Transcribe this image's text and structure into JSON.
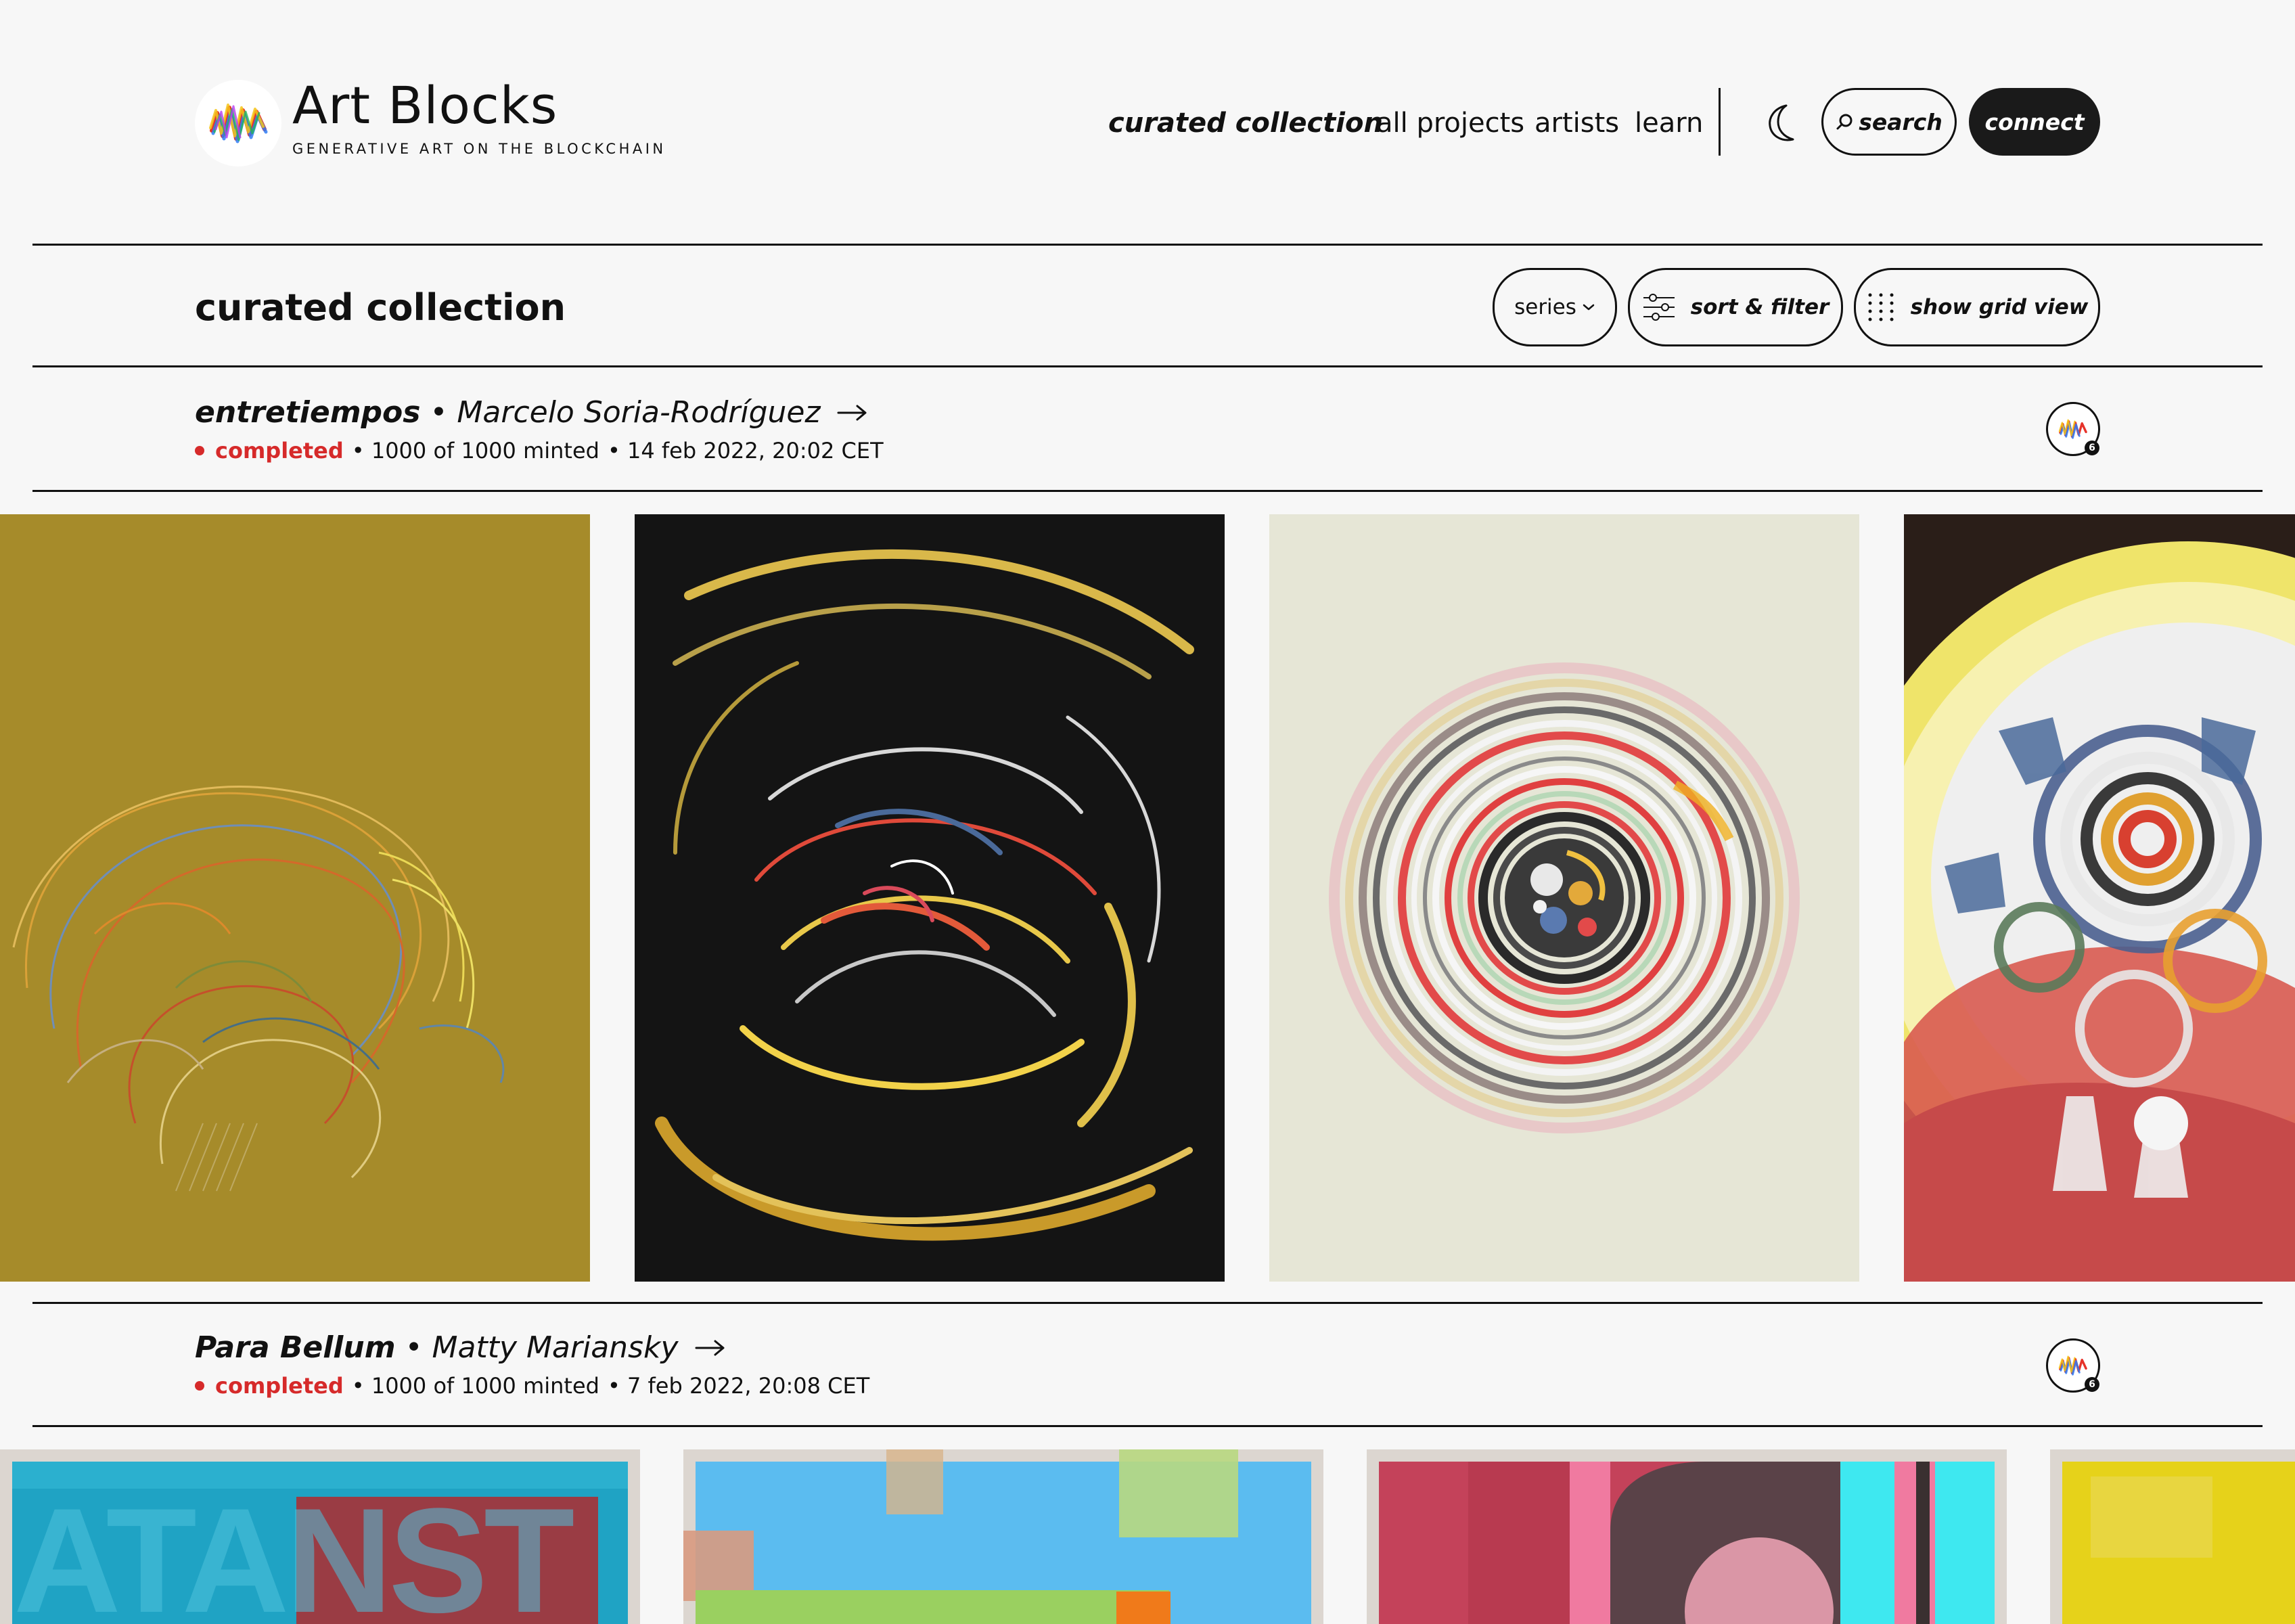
{
  "brand": {
    "name": "Art Blocks",
    "tagline": "GENERATIVE ART ON THE BLOCKCHAIN"
  },
  "nav": {
    "items": [
      {
        "label": "curated collection",
        "active": true
      },
      {
        "label": "all projects"
      },
      {
        "label": "artists"
      },
      {
        "label": "learn"
      }
    ],
    "theme_icon": "moon-icon",
    "search_label": "search",
    "connect_label": "connect"
  },
  "page": {
    "title": "curated collection",
    "controls": {
      "series_label": "series",
      "sort_label": "sort & filter",
      "grid_label": "show grid view"
    }
  },
  "projects": [
    {
      "name": "entretiempos",
      "artist": "Marcelo Soria-Rodríguez",
      "separator": "•",
      "status": "completed",
      "minted": "• 1000 of 1000 minted",
      "date": "• 14 feb 2022, 20:02 CET",
      "badge_count": "6",
      "status_color": "#d62a2a"
    },
    {
      "name": "Para Bellum",
      "artist": "Matty Mariansky",
      "separator": "•",
      "status": "completed",
      "minted": "• 1000 of 1000 minted",
      "date": "• 7 feb 2022, 20:08 CET",
      "badge_count": "6",
      "status_color": "#d62a2a"
    }
  ],
  "artwork_text": {
    "para_bellum_1": "ATANST"
  },
  "colors": {
    "background": "#f7f7f7",
    "text": "#111111",
    "status_red": "#d62a2a",
    "connect_bg": "#1a1a1a"
  }
}
